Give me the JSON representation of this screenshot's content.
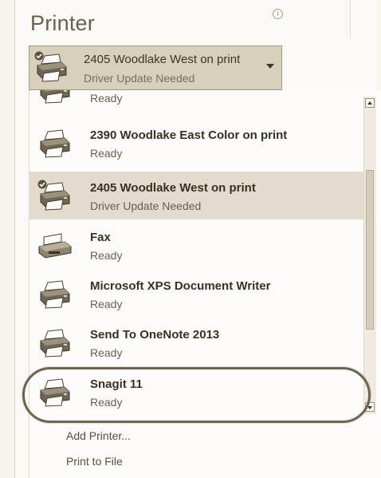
{
  "section": {
    "title": "Printer",
    "info_icon": "info-icon"
  },
  "selected_printer": {
    "name": "2405 Woodlake West on print",
    "status": "Driver Update Needed"
  },
  "printers": [
    {
      "name": "",
      "status": "Ready"
    },
    {
      "name": "2390 Woodlake East Color on print",
      "status": "Ready"
    },
    {
      "name": "2405 Woodlake West on print",
      "status": "Driver Update Needed"
    },
    {
      "name": "Fax",
      "status": "Ready"
    },
    {
      "name": "Microsoft XPS Document Writer",
      "status": "Ready"
    },
    {
      "name": "Send To OneNote 2013",
      "status": "Ready"
    },
    {
      "name": "Snagit 11",
      "status": "Ready"
    }
  ],
  "actions": {
    "add_printer": "Add Printer...",
    "print_to_file": "Print to File"
  },
  "colors": {
    "highlight_background": "#e2dbce",
    "selected_background": "#d9cfbd",
    "annotation_oval": "#6f6350"
  }
}
